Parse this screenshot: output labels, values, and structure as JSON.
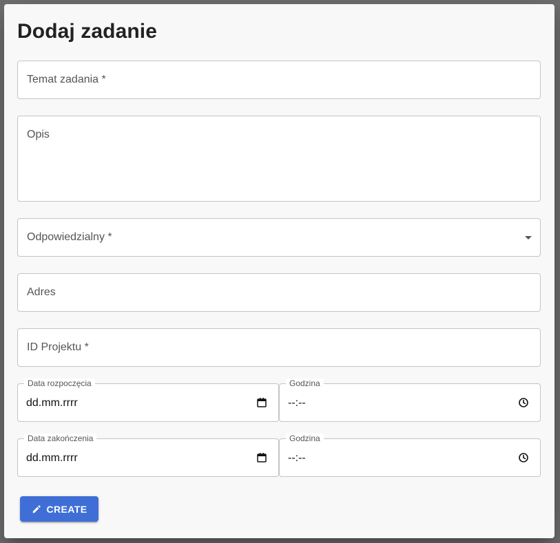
{
  "dialog": {
    "title": "Dodaj zadanie"
  },
  "form": {
    "temat_label": "Temat zadania *",
    "opis_label": "Opis",
    "odpowiedzialny_label": "Odpowiedzialny *",
    "adres_label": "Adres",
    "id_projektu_label": "ID Projektu *",
    "start_date": {
      "label": "Data rozpoczęcia",
      "value": "dd.mm.rrrr"
    },
    "start_time": {
      "label": "Godzina",
      "value": "--:--"
    },
    "end_date": {
      "label": "Data zakończenia",
      "value": "dd.mm.rrrr"
    },
    "end_time": {
      "label": "Godzina",
      "value": "--:--"
    }
  },
  "actions": {
    "create_label": "CREATE"
  },
  "icons": {
    "dropdown": "chevron-down-icon",
    "calendar": "calendar-icon",
    "clock": "clock-icon",
    "pencil": "pencil-icon"
  },
  "colors": {
    "accent": "#3f6fd6",
    "dialog_bg": "#f8f8f8",
    "border": "#c4c4c4"
  }
}
